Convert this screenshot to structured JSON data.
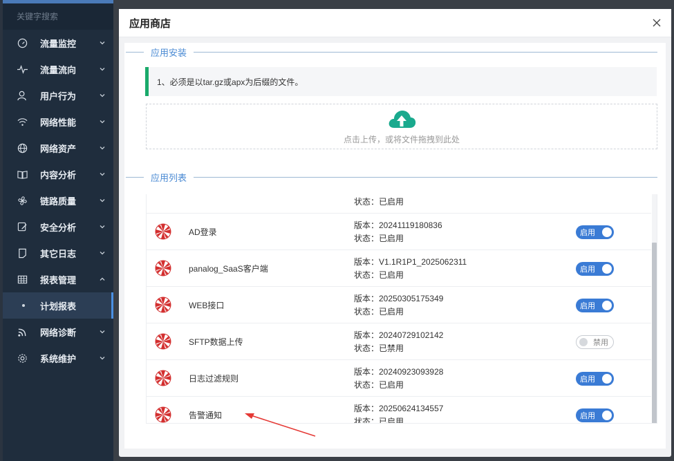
{
  "sidebar": {
    "search_placeholder": "关键字搜索",
    "items": [
      {
        "label": "流量监控",
        "icon": "gauge-icon"
      },
      {
        "label": "流量流向",
        "icon": "pulse-icon"
      },
      {
        "label": "用户行为",
        "icon": "user-icon"
      },
      {
        "label": "网络性能",
        "icon": "wifi-icon"
      },
      {
        "label": "网络资产",
        "icon": "globe-icon"
      },
      {
        "label": "内容分析",
        "icon": "book-icon"
      },
      {
        "label": "链路质量",
        "icon": "fan-icon"
      },
      {
        "label": "安全分析",
        "icon": "shield-edit-icon"
      },
      {
        "label": "其它日志",
        "icon": "document-icon"
      },
      {
        "label": "报表管理",
        "icon": "table-icon"
      }
    ],
    "active_sub": "计划报表",
    "items_after": [
      {
        "label": "网络诊断",
        "icon": "rss-icon"
      },
      {
        "label": "系统维护",
        "icon": "gear-icon"
      }
    ]
  },
  "modal": {
    "title": "应用商店",
    "install_section": "应用安装",
    "tip": "1、必须是以tar.gz或apx为后缀的文件。",
    "upload_text": "点击上传，或将文件拖拽到此处",
    "list_section": "应用列表",
    "partial_row_status": "状态：已启用",
    "apps": [
      {
        "name": "AD登录",
        "version": "版本：20241119180836",
        "status": "状态：已启用",
        "toggle": "启用",
        "enabled": true
      },
      {
        "name": "panalog_SaaS客户端",
        "version": "版本：V1.1R1P1_2025062311",
        "status": "状态：已启用",
        "toggle": "启用",
        "enabled": true
      },
      {
        "name": "WEB接口",
        "version": "版本：20250305175349",
        "status": "状态：已启用",
        "toggle": "启用",
        "enabled": true
      },
      {
        "name": "SFTP数据上传",
        "version": "版本：20240729102142",
        "status": "状态：已禁用",
        "toggle": "禁用",
        "enabled": false
      },
      {
        "name": "日志过滤规则",
        "version": "版本：20240923093928",
        "status": "状态：已启用",
        "toggle": "启用",
        "enabled": true
      },
      {
        "name": "告警通知",
        "version": "版本：20250624134557",
        "status": "状态：已启用",
        "toggle": "启用",
        "enabled": true
      }
    ]
  },
  "colors": {
    "accent": "#3a7bd5",
    "tip_bar": "#1aaa6b",
    "upload_icon": "#1aaa8e",
    "arrow": "#e53935",
    "logo": "#d32f2f"
  }
}
